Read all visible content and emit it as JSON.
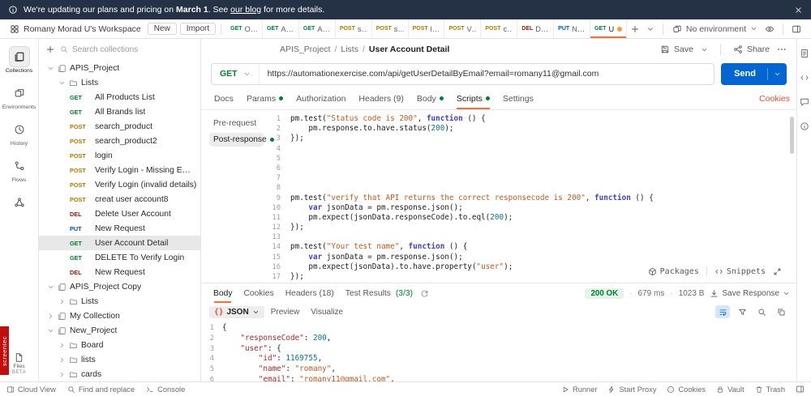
{
  "banner": {
    "text_prefix": "We're updating our plans and pricing on ",
    "date_bold": "March 1",
    "text_mid": ". See ",
    "link_text": "our blog",
    "text_suffix": " for more details."
  },
  "topbar": {
    "workspace_name": "Romany Morad U's Workspace",
    "new_label": "New",
    "import_label": "Import",
    "environment": "No environment",
    "tabs": [
      {
        "method": "GET",
        "label": "Overvi"
      },
      {
        "method": "GET",
        "label": "All Prc"
      },
      {
        "method": "GET",
        "label": "All Brc"
      },
      {
        "method": "POST",
        "label": "searc"
      },
      {
        "method": "POST",
        "label": "searc"
      },
      {
        "method": "POST",
        "label": "logi"
      },
      {
        "method": "POST",
        "label": "Verif"
      },
      {
        "method": "POST",
        "label": "creat"
      },
      {
        "method": "DEL",
        "label": "Delete"
      },
      {
        "method": "PUT",
        "label": "New F"
      },
      {
        "method": "GET",
        "label": "User A",
        "active": true,
        "dirty": true
      }
    ]
  },
  "left_rail": {
    "items": [
      {
        "name": "collections",
        "icon": "collection",
        "label": "Collections",
        "active": true
      },
      {
        "name": "environments",
        "icon": "env",
        "label": "Environments"
      },
      {
        "name": "history",
        "icon": "clock",
        "label": "History"
      },
      {
        "name": "flows",
        "icon": "flows",
        "label": "Flows"
      },
      {
        "name": "more",
        "icon": "network",
        "label": ""
      }
    ],
    "files_label": "Files",
    "files_beta": "BETA"
  },
  "sidebar": {
    "search_placeholder": "Search collections",
    "tree": [
      {
        "kind": "collection",
        "chevron": "down",
        "label": "APIS_Project",
        "indent": 0
      },
      {
        "kind": "folder",
        "chevron": "down",
        "label": "Lists",
        "indent": 1
      },
      {
        "kind": "request",
        "method": "GET",
        "label": "All Products List",
        "indent": 2
      },
      {
        "kind": "request",
        "method": "GET",
        "label": "All Brands list",
        "indent": 2
      },
      {
        "kind": "request",
        "method": "POST",
        "label": "search_product",
        "indent": 2
      },
      {
        "kind": "request",
        "method": "POST",
        "label": "search_product2",
        "indent": 2
      },
      {
        "kind": "request",
        "method": "POST",
        "label": "login",
        "indent": 2
      },
      {
        "kind": "request",
        "method": "POST",
        "label": "Verify Login - Missing Email",
        "indent": 2
      },
      {
        "kind": "request",
        "method": "POST",
        "label": "Verify Login (invalid details)",
        "indent": 2
      },
      {
        "kind": "request",
        "method": "POST",
        "label": "creat user account8",
        "indent": 2
      },
      {
        "kind": "request",
        "method": "DEL",
        "label": "Delete User Account",
        "indent": 2
      },
      {
        "kind": "request",
        "method": "PUT",
        "label": "New Request",
        "indent": 2
      },
      {
        "kind": "request",
        "method": "GET",
        "label": "User Account Detail",
        "indent": 2,
        "selected": true
      },
      {
        "kind": "request",
        "method": "GET",
        "label": "DELETE To Verify Login",
        "indent": 2
      },
      {
        "kind": "request",
        "method": "DEL",
        "label": "New Request",
        "indent": 2
      },
      {
        "kind": "collection",
        "chevron": "down",
        "label": "APIS_Project Copy",
        "indent": 0
      },
      {
        "kind": "folder",
        "chevron": "right",
        "label": "Lists",
        "indent": 1
      },
      {
        "kind": "collection",
        "chevron": "right",
        "label": "My Collection",
        "indent": 0
      },
      {
        "kind": "collection",
        "chevron": "down",
        "label": "New_Project",
        "indent": 0
      },
      {
        "kind": "folder",
        "chevron": "right",
        "label": "Board",
        "indent": 1
      },
      {
        "kind": "folder",
        "chevron": "right",
        "label": "lists",
        "indent": 1
      },
      {
        "kind": "folder",
        "chevron": "right",
        "label": "cards",
        "indent": 1
      }
    ]
  },
  "request": {
    "breadcrumb": [
      "APIS_Project",
      "Lists",
      "User Account Detail"
    ],
    "save_label": "Save",
    "share_label": "Share",
    "method": "GET",
    "url": "https://automationexercise.com/api/getUserDetailByEmail?email=romany11@gmail.com",
    "send_label": "Send",
    "tabs": [
      {
        "label": "Docs"
      },
      {
        "label": "Params",
        "dot": true
      },
      {
        "label": "Authorization"
      },
      {
        "label": "Headers (9)"
      },
      {
        "label": "Body",
        "dot": true
      },
      {
        "label": "Scripts",
        "dot": true,
        "active": true
      },
      {
        "label": "Settings"
      }
    ],
    "cookies_link": "Cookies"
  },
  "scripts": {
    "subnav": [
      {
        "label": "Pre-request"
      },
      {
        "label": "Post-response",
        "dot": true,
        "active": true
      }
    ],
    "packages_label": "Packages",
    "snippets_label": "Snippets",
    "code_lines": [
      [
        [
          "p",
          "pm.test("
        ],
        [
          "s",
          "\"Status code is 200\""
        ],
        [
          "p",
          ", "
        ],
        [
          "k",
          "function"
        ],
        [
          "p",
          " () {"
        ]
      ],
      [
        [
          "p",
          "    pm.response.to.have.status("
        ],
        [
          "n",
          "200"
        ],
        [
          "p",
          ");"
        ]
      ],
      [
        [
          "p",
          "});"
        ]
      ],
      [],
      [],
      [],
      [],
      [],
      [
        [
          "p",
          "pm.test("
        ],
        [
          "s",
          "\"verify that API returns the correct responsecode is 200\""
        ],
        [
          "p",
          ", "
        ],
        [
          "k",
          "function"
        ],
        [
          "p",
          " () {"
        ]
      ],
      [
        [
          "p",
          "    "
        ],
        [
          "k",
          "var"
        ],
        [
          "p",
          " jsonData = pm.response.json();"
        ]
      ],
      [
        [
          "p",
          "    pm.expect(jsonData.responseCode).to.eql("
        ],
        [
          "n",
          "200"
        ],
        [
          "p",
          ");"
        ]
      ],
      [
        [
          "p",
          "});"
        ]
      ],
      [],
      [
        [
          "p",
          "pm.test("
        ],
        [
          "s",
          "\"Your test name\""
        ],
        [
          "p",
          ", "
        ],
        [
          "k",
          "function"
        ],
        [
          "p",
          " () {"
        ]
      ],
      [
        [
          "p",
          "    "
        ],
        [
          "k",
          "var"
        ],
        [
          "p",
          " jsonData = pm.response.json();"
        ]
      ],
      [
        [
          "p",
          "    pm.expect(jsonData).to.have.property("
        ],
        [
          "s",
          "\"user\""
        ],
        [
          "p",
          ");"
        ]
      ],
      [
        [
          "p",
          "});"
        ]
      ]
    ]
  },
  "response": {
    "tabs": [
      {
        "label": "Body",
        "active": true
      },
      {
        "label": "Cookies"
      },
      {
        "label": "Headers (18)"
      },
      {
        "label": "Test Results",
        "count": "(3/3)"
      }
    ],
    "status": "200 OK",
    "time": "679 ms",
    "size": "1023 B",
    "save_response_label": "Save Response",
    "view_tabs": [
      {
        "label": "JSON",
        "braces": true,
        "chev": true,
        "active": true
      },
      {
        "label": "Preview"
      },
      {
        "label": "Visualize"
      }
    ],
    "body_lines": [
      [
        [
          "p",
          "{"
        ]
      ],
      [
        [
          "p",
          "    "
        ],
        [
          "key",
          "\"responseCode\""
        ],
        [
          "p",
          ": "
        ],
        [
          "n",
          "200"
        ],
        [
          "p",
          ","
        ]
      ],
      [
        [
          "p",
          "    "
        ],
        [
          "key",
          "\"user\""
        ],
        [
          "p",
          ": {"
        ]
      ],
      [
        [
          "p",
          "        "
        ],
        [
          "key",
          "\"id\""
        ],
        [
          "p",
          ": "
        ],
        [
          "n",
          "1169755"
        ],
        [
          "p",
          ","
        ]
      ],
      [
        [
          "p",
          "        "
        ],
        [
          "key",
          "\"name\""
        ],
        [
          "p",
          ": "
        ],
        [
          "s",
          "\"romany\""
        ],
        [
          "p",
          ","
        ]
      ],
      [
        [
          "p",
          "        "
        ],
        [
          "key",
          "\"email\""
        ],
        [
          "p",
          ": "
        ],
        [
          "s",
          "\"romany11@gmail.com\""
        ],
        [
          "p",
          ","
        ]
      ]
    ]
  },
  "statusbar": {
    "left": [
      {
        "icon": "panel",
        "label": "Cloud View"
      },
      {
        "icon": "search",
        "label": "Find and replace"
      },
      {
        "icon": "console",
        "label": "Console"
      }
    ],
    "right": [
      {
        "icon": "runner",
        "label": "Runner"
      },
      {
        "icon": "bolt",
        "label": "Start Proxy"
      },
      {
        "icon": "cookie",
        "label": "Cookies"
      },
      {
        "icon": "lock",
        "label": "Vault"
      },
      {
        "icon": "trash",
        "label": "Trash"
      }
    ]
  },
  "badge": {
    "text": "screentec"
  },
  "colors": {
    "accent": "#ff6c37",
    "send_button": "#0265d2",
    "get": "#007f31",
    "post": "#ad7a03",
    "put": "#0053b8",
    "delete": "#8e1a10",
    "success": "#007f31",
    "banner_bg": "#253246",
    "badge_bg": "#c20d0d"
  }
}
